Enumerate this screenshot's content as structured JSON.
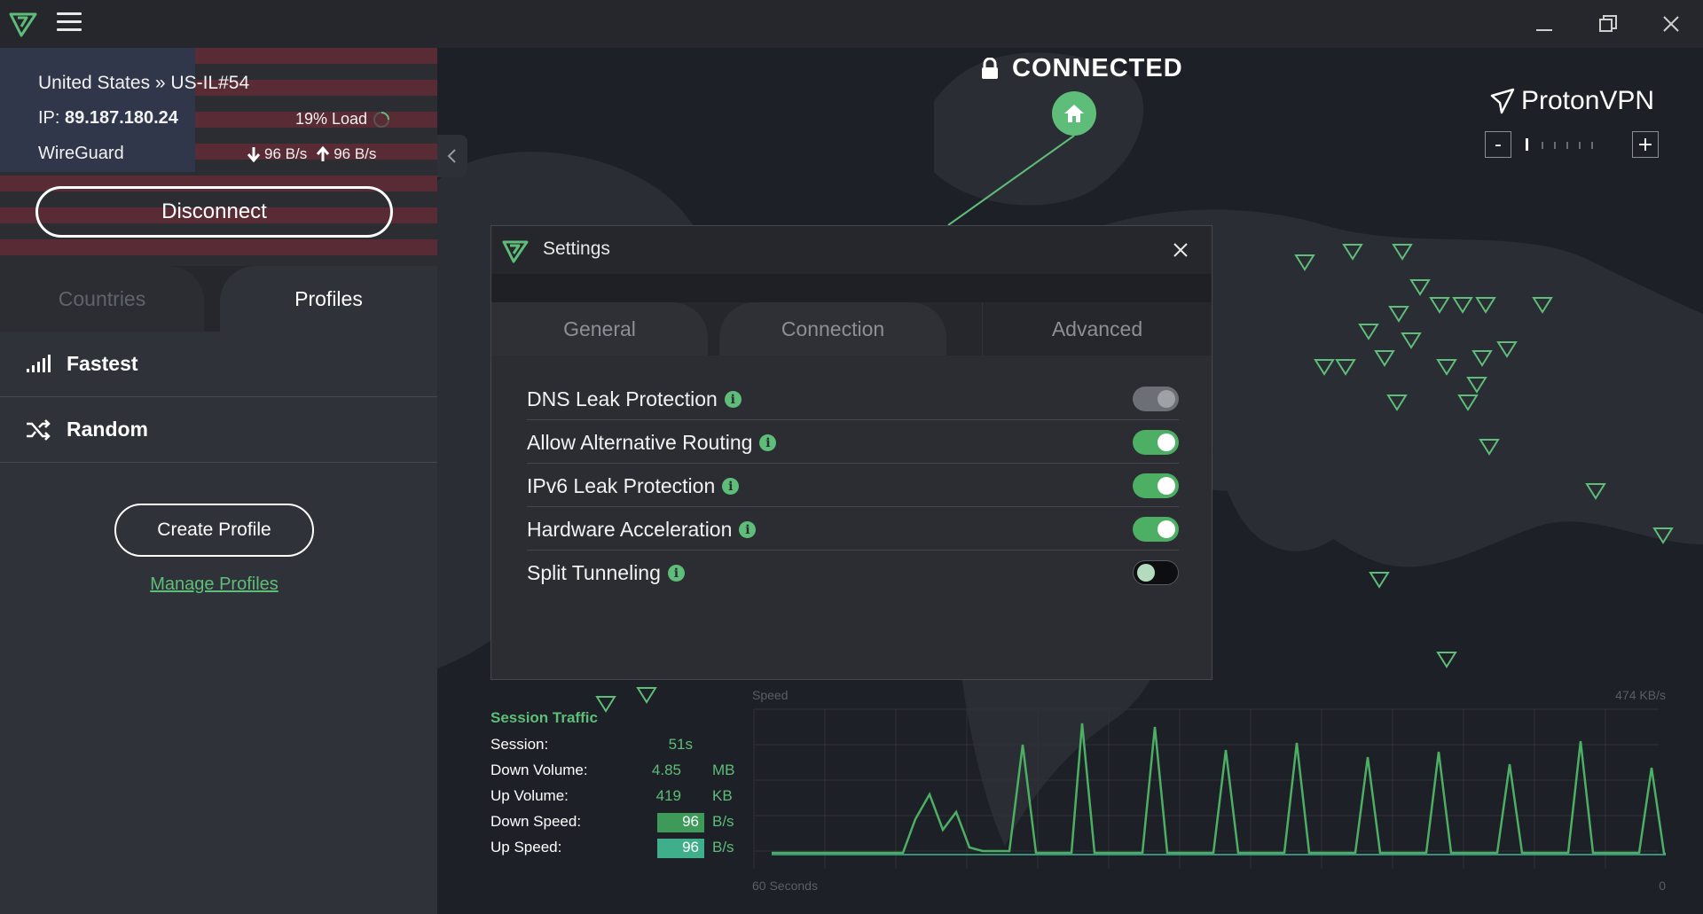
{
  "window": {
    "minimize_glyph": "—",
    "maximize_glyph": "❐",
    "close_glyph": "✕"
  },
  "connection": {
    "location": "United States » US-IL#54",
    "ip_label": "IP: ",
    "ip": "89.187.180.24",
    "load": "19% Load",
    "protocol": "WireGuard",
    "down_rate": "96 B/s",
    "up_rate": "96 B/s",
    "disconnect_label": "Disconnect"
  },
  "sidebar": {
    "tabs": [
      {
        "label": "Countries",
        "active": false
      },
      {
        "label": "Profiles",
        "active": true
      }
    ],
    "profiles": [
      {
        "label": "Fastest",
        "icon": "signal-bars-icon"
      },
      {
        "label": "Random",
        "icon": "shuffle-icon"
      }
    ],
    "create_profile_label": "Create Profile",
    "manage_profiles_label": "Manage Profiles",
    "collapse_glyph": "‹"
  },
  "map": {
    "status": "CONNECTED",
    "brand": "ProtonVPN",
    "zoom_out": "-",
    "zoom_in": "+"
  },
  "settings": {
    "title": "Settings",
    "close_glyph": "✕",
    "tabs": [
      {
        "label": "General",
        "active": false
      },
      {
        "label": "Connection",
        "active": false
      },
      {
        "label": "Advanced",
        "active": true
      }
    ],
    "options": [
      {
        "label": "DNS Leak Protection",
        "state": "disabled-on"
      },
      {
        "label": "Allow Alternative Routing",
        "state": "on"
      },
      {
        "label": "IPv6 Leak Protection",
        "state": "on"
      },
      {
        "label": "Hardware Acceleration",
        "state": "on"
      },
      {
        "label": "Split Tunneling",
        "state": "off"
      }
    ],
    "info_glyph": "i"
  },
  "traffic": {
    "title": "Session Traffic",
    "session_label": "Session:",
    "session_value": "51s",
    "down_volume_label": "Down Volume:",
    "down_volume_value": "4.85",
    "down_volume_unit": "MB",
    "up_volume_label": "Up Volume:",
    "up_volume_value": "419",
    "up_volume_unit": "KB",
    "down_speed_label": "Down Speed:",
    "down_speed_value": "96",
    "down_speed_unit": "B/s",
    "up_speed_label": "Up Speed:",
    "up_speed_value": "96",
    "up_speed_unit": "B/s"
  },
  "graph": {
    "title": "Speed",
    "max_label": "474  KB/s",
    "x_left_label": "60 Seconds",
    "x_right_label": "0",
    "colors": {
      "down": "#4caf63",
      "up": "#3fae8a"
    }
  },
  "colors": {
    "accent": "#5ebd78",
    "background": "#1b1e24",
    "sidebar": "#303239"
  }
}
